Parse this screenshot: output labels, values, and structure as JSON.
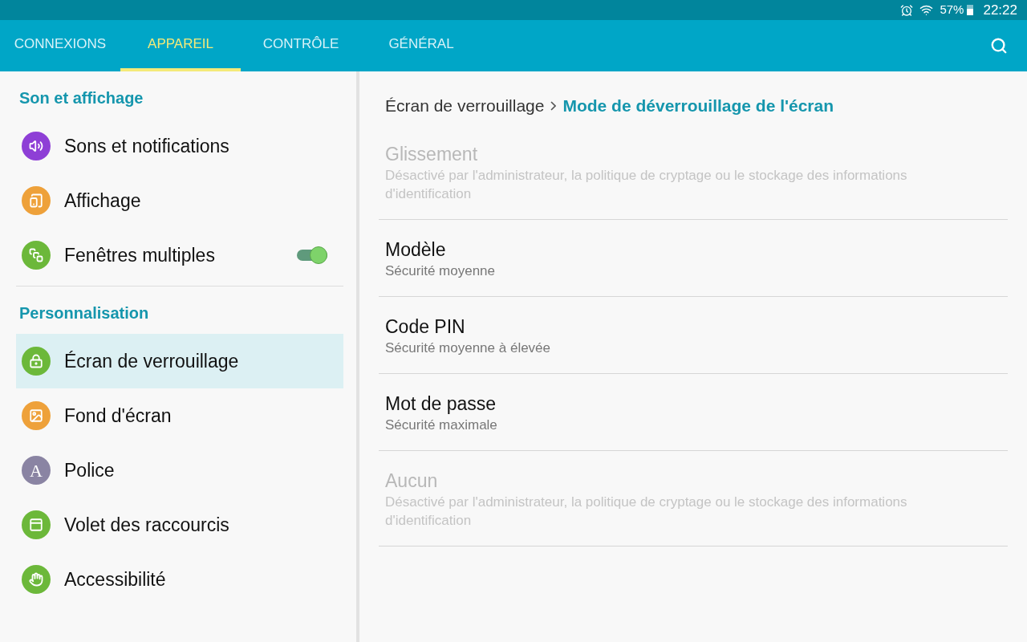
{
  "status_bar": {
    "battery_percent": "57%",
    "time": "22:22"
  },
  "tabs": [
    {
      "label": "CONNEXIONS",
      "selected": false
    },
    {
      "label": "APPAREIL",
      "selected": true
    },
    {
      "label": "CONTRÔLE",
      "selected": false
    },
    {
      "label": "GÉNÉRAL",
      "selected": false
    }
  ],
  "sidebar": {
    "sections": [
      {
        "title": "Son et affichage",
        "items": [
          {
            "label": "Sons et notifications",
            "kind": "speaker",
            "color": "#8e3fd6",
            "selected": false
          },
          {
            "label": "Affichage",
            "kind": "display",
            "color": "#eea13a",
            "selected": false
          },
          {
            "label": "Fenêtres multiples",
            "kind": "windows",
            "color": "#6cb83a",
            "selected": false,
            "toggle_on": true
          }
        ]
      },
      {
        "title": "Personnalisation",
        "items": [
          {
            "label": "Écran de verrouillage",
            "kind": "lock",
            "color": "#6cb83a",
            "selected": true
          },
          {
            "label": "Fond d'écran",
            "kind": "image",
            "color": "#eea13a",
            "selected": false
          },
          {
            "label": "Police",
            "kind": "letter",
            "glyph": "A",
            "color": "#8a84a3",
            "selected": false
          },
          {
            "label": "Volet des raccourcis",
            "kind": "panel",
            "color": "#6cb83a",
            "selected": false
          },
          {
            "label": "Accessibilité",
            "kind": "hand",
            "color": "#6cb83a",
            "selected": false
          }
        ]
      }
    ]
  },
  "breadcrumb": {
    "parent": "Écran de verrouillage",
    "current": "Mode de déverrouillage de l'écran"
  },
  "options": [
    {
      "title": "Glissement",
      "subtitle": "Désactivé par l'administrateur, la politique de cryptage ou le stockage des informations d'identification",
      "disabled": true
    },
    {
      "title": "Modèle",
      "subtitle": "Sécurité moyenne",
      "disabled": false
    },
    {
      "title": "Code PIN",
      "subtitle": "Sécurité moyenne à élevée",
      "disabled": false
    },
    {
      "title": "Mot de passe",
      "subtitle": "Sécurité maximale",
      "disabled": false
    },
    {
      "title": "Aucun",
      "subtitle": "Désactivé par l'administrateur, la politique de cryptage ou le stockage des informations d'identification",
      "disabled": true
    }
  ]
}
